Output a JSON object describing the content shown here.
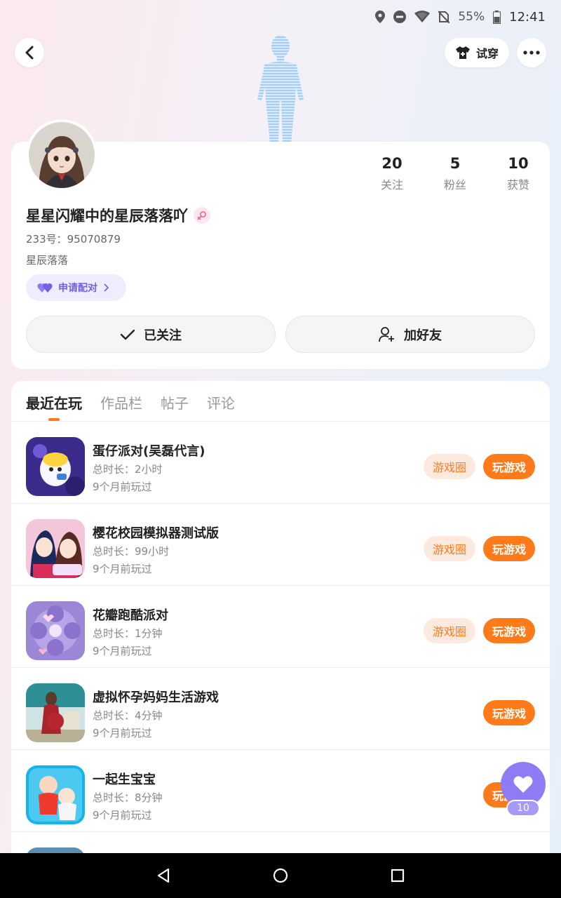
{
  "status_bar": {
    "battery": "55%",
    "time": "12:41",
    "icons": [
      "location-icon",
      "dnd-icon",
      "wifi-icon",
      "no-sim-icon",
      "battery-icon"
    ]
  },
  "header": {
    "back_icon": "chevron-left-icon",
    "tryon_label": "试穿",
    "more_icon": "more-dots-icon"
  },
  "profile": {
    "stats": [
      {
        "value": "20",
        "label": "关注"
      },
      {
        "value": "5",
        "label": "粉丝"
      },
      {
        "value": "10",
        "label": "获赞"
      }
    ],
    "nickname": "星星闪耀中的星辰落落吖",
    "gender": "female",
    "uid": "233号：95070879",
    "bio": "星辰落落",
    "match_label": "申请配对",
    "follow_label": "已关注",
    "add_friend_label": "加好友"
  },
  "tabs": [
    {
      "label": "最近在玩",
      "active": true
    },
    {
      "label": "作品栏",
      "active": false
    },
    {
      "label": "帖子",
      "active": false
    },
    {
      "label": "评论",
      "active": false
    }
  ],
  "games": [
    {
      "name": "蛋仔派对(吴磊代言)",
      "duration": "总时长：2小时",
      "last_played": "9个月前玩过",
      "circle_label": "游戏圈",
      "play_label": "玩游戏"
    },
    {
      "name": "樱花校园模拟器测试版",
      "duration": "总时长：99小时",
      "last_played": "9个月前玩过",
      "circle_label": "游戏圈",
      "play_label": "玩游戏"
    },
    {
      "name": "花瓣跑酷派对",
      "duration": "总时长：1分钟",
      "last_played": "9个月前玩过",
      "circle_label": "游戏圈",
      "play_label": "玩游戏"
    },
    {
      "name": "虚拟怀孕妈妈生活游戏",
      "duration": "总时长：4分钟",
      "last_played": "9个月前玩过",
      "play_label": "玩游戏"
    },
    {
      "name": "一起生宝宝",
      "duration": "总时长：8分钟",
      "last_played": "9个月前玩过",
      "play_label": "玩游戏"
    }
  ],
  "fab": {
    "icon": "heart-icon",
    "count": "10"
  },
  "colors": {
    "accent": "#ff7a1a",
    "purple": "#8f7cf5",
    "match_text": "#6f62e6"
  }
}
